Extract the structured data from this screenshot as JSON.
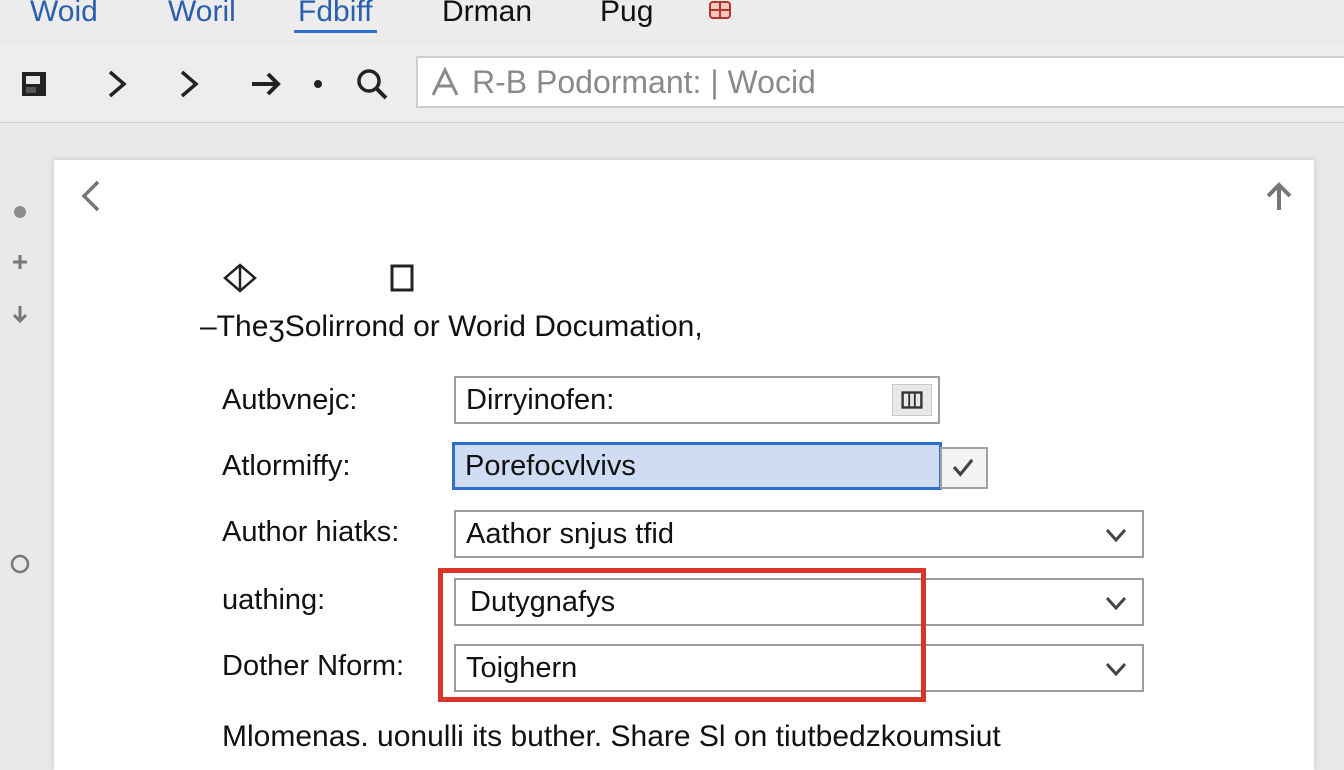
{
  "tabs": [
    {
      "label": "Woid",
      "active": false
    },
    {
      "label": "Woril",
      "active": false
    },
    {
      "label": "Fdbiff",
      "active": true
    },
    {
      "label": "Drman",
      "active": false
    },
    {
      "label": "Pug",
      "active": false
    }
  ],
  "tab_icon": "grid-icon",
  "toolbar": {
    "icons": [
      "save-icon",
      "forward-icon",
      "forward-icon",
      "arrow-right-icon",
      "dot-icon",
      "search-icon"
    ],
    "address_text": "R-B  Podormant: | Wocid"
  },
  "gutter_icons": [
    "dot-icon",
    "plus-icon",
    "arrow-down-icon",
    "circle-icon"
  ],
  "document": {
    "title": "–TheʒSolirrond or Worid Documation,",
    "fields": [
      {
        "label": "Autbvnejc:",
        "value": "Dirryinofen:",
        "control": "button"
      },
      {
        "label": "Atlormiffy:",
        "value": "Porefocvlvivs",
        "control": "checkbox",
        "selected": true
      },
      {
        "label": "Author hiatks:",
        "value": "Aathor snjus tfid",
        "control": "dropdown"
      },
      {
        "label": "uathing:",
        "value": "Dutygnafys",
        "control": "dropdown"
      },
      {
        "label": "Dother Nform:",
        "value": "Toighern",
        "control": "dropdown"
      }
    ],
    "footer": "Mlomenas. uonulli its buther. Share Sl on tiutbedzkoumsiut"
  },
  "colors": {
    "accent": "#2f6fd0",
    "highlight": "#d9362a",
    "selected_fill": "#cfdcf4"
  }
}
